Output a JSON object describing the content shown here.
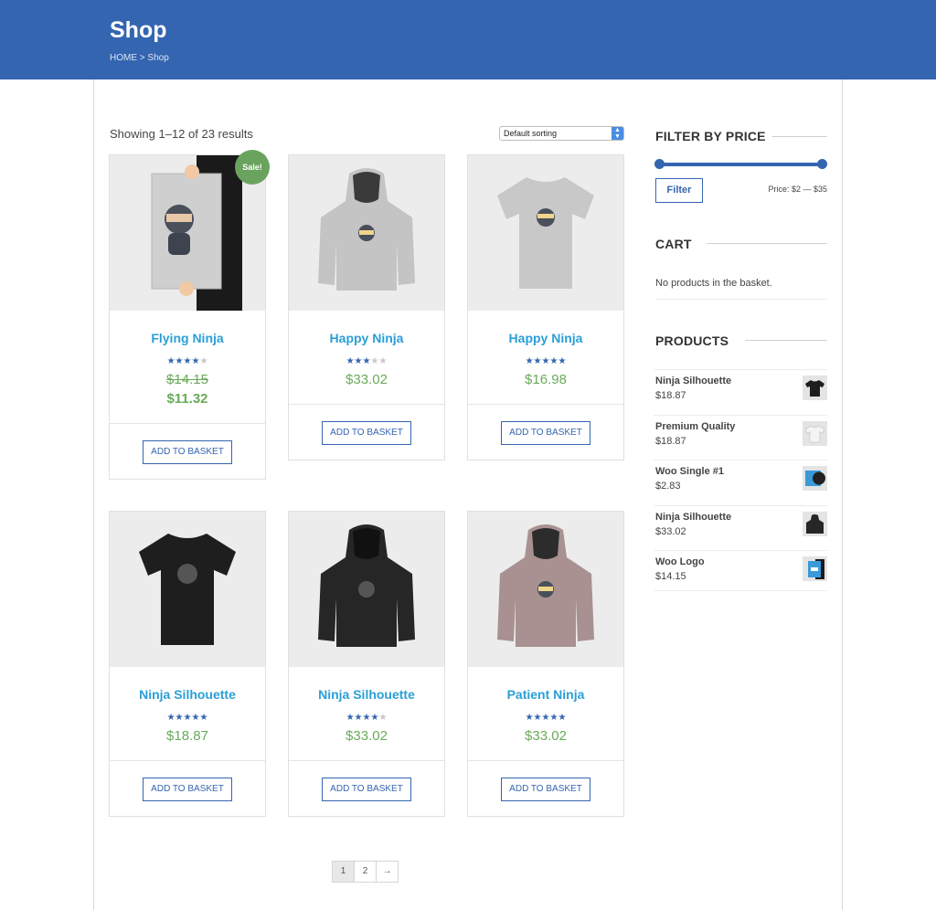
{
  "header": {
    "title": "Shop",
    "breadcrumb_home": "HOME",
    "breadcrumb_sep": " > ",
    "breadcrumb_current": "Shop"
  },
  "shop": {
    "result_count": "Showing 1–12 of 23 results",
    "sorting": "Default sorting",
    "sale_badge": "Sale!",
    "add_to_basket": "ADD TO BASKET",
    "products": [
      {
        "name": "Flying Ninja",
        "rating": 4,
        "old_price": "$14.15",
        "price": "$11.32",
        "on_sale": true
      },
      {
        "name": "Happy Ninja",
        "rating": 3,
        "price": "$33.02"
      },
      {
        "name": "Happy Ninja",
        "rating": 5,
        "price": "$16.98"
      },
      {
        "name": "Ninja Silhouette",
        "rating": 5,
        "price": "$18.87"
      },
      {
        "name": "Ninja Silhouette",
        "rating": 4,
        "price": "$33.02"
      },
      {
        "name": "Patient Ninja",
        "rating": 5,
        "price": "$33.02"
      }
    ]
  },
  "pagination": {
    "page1": "1",
    "page2": "2",
    "next": "→"
  },
  "sidebar": {
    "filter": {
      "title": "FILTER BY PRICE",
      "button": "Filter",
      "range": "Price: $2 — $35"
    },
    "cart": {
      "title": "CART",
      "empty": "No products in the basket."
    },
    "products": {
      "title": "PRODUCTS",
      "items": [
        {
          "name": "Ninja Silhouette",
          "price": "$18.87"
        },
        {
          "name": "Premium Quality",
          "price": "$18.87"
        },
        {
          "name": "Woo Single #1",
          "price": "$2.83"
        },
        {
          "name": "Ninja Silhouette",
          "price": "$33.02"
        },
        {
          "name": "Woo Logo",
          "price": "$14.15"
        }
      ]
    }
  },
  "colors": {
    "brand": "#3465b0",
    "link": "#2a9fd6",
    "price": "#6aaa5a",
    "sale": "#6aa35e"
  }
}
